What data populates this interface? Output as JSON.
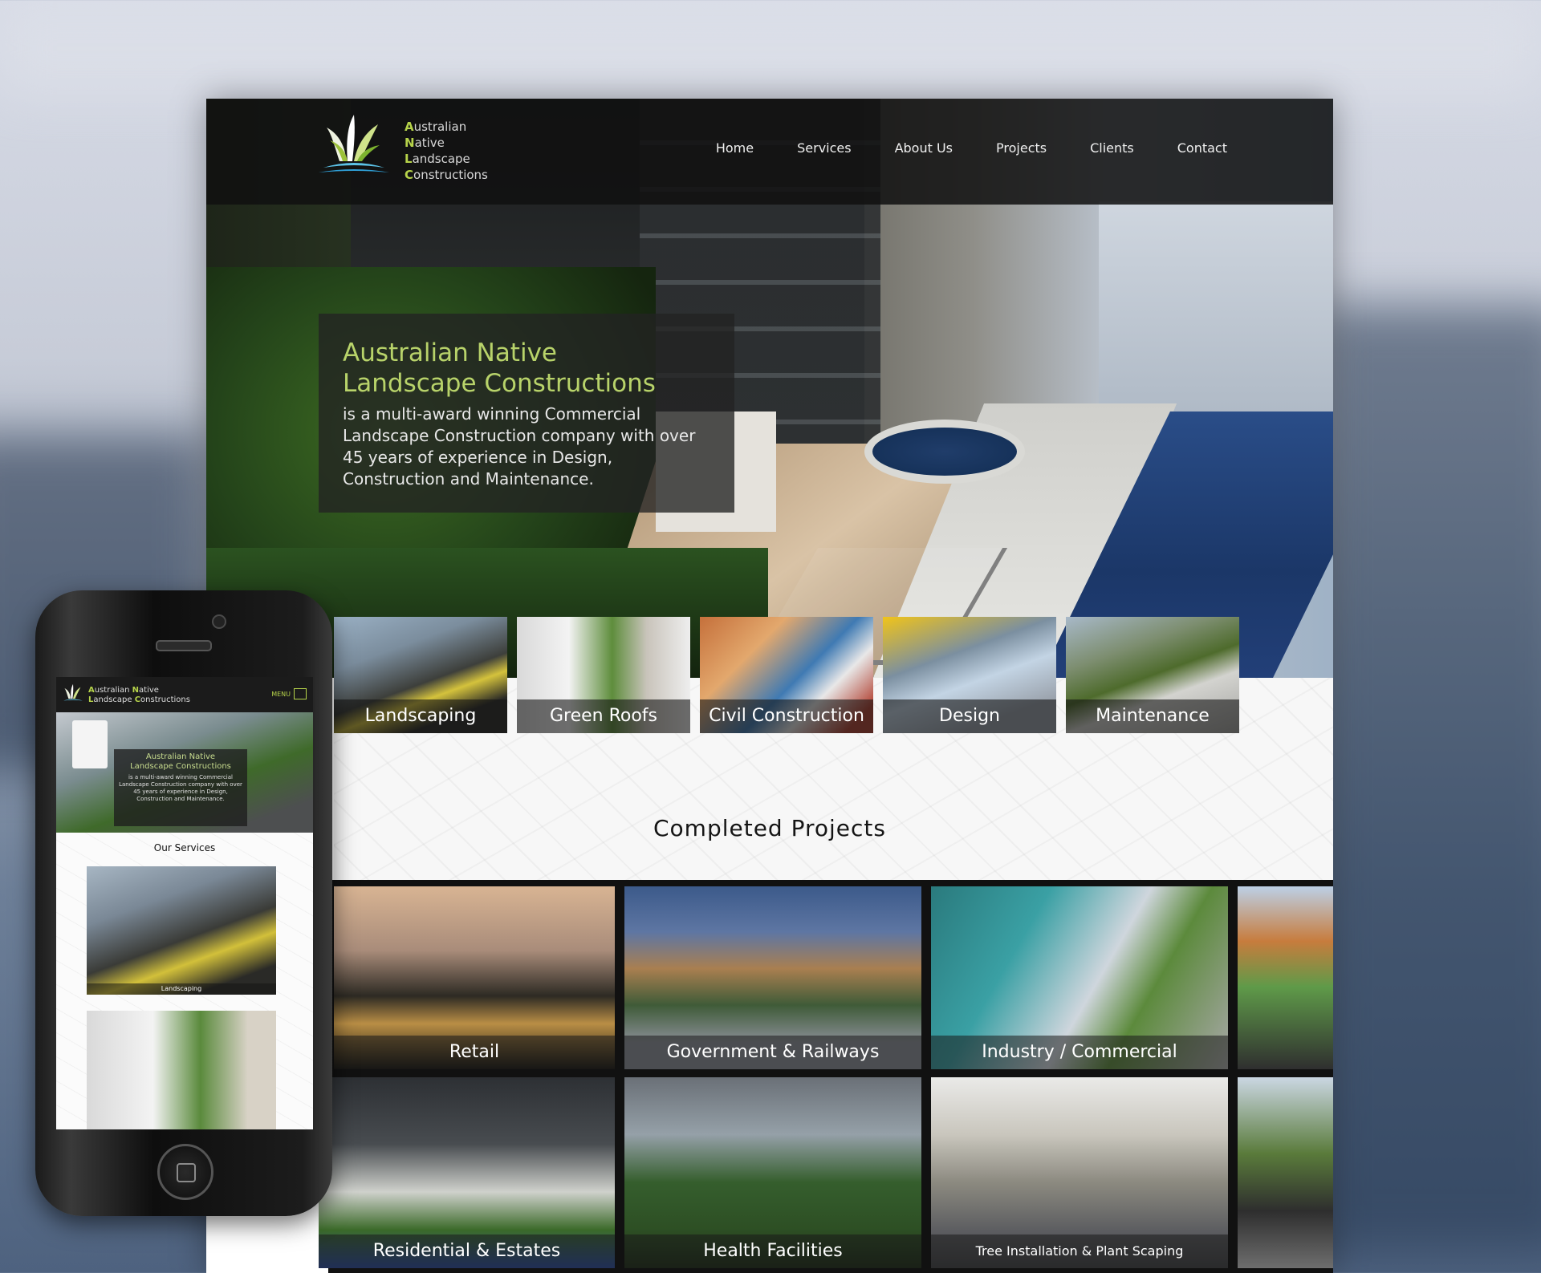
{
  "brand": {
    "line1_cap": "A",
    "line1_rest": "ustralian",
    "line2_cap": "N",
    "line2_rest": "ative",
    "line3_cap": "L",
    "line3_rest": "andscape",
    "line4_cap": "C",
    "line4_rest": "onstructions",
    "accent_color": "#b6d34a"
  },
  "nav": {
    "items": [
      "Home",
      "Services",
      "About Us",
      "Projects",
      "Clients",
      "Contact"
    ]
  },
  "hero": {
    "title_line1": "Australian Native",
    "title_line2": "Landscape Constructions",
    "description": "is a multi-award winning Commercial Landscape Construction company with over 45 years of experience in Design, Construction and Maintenance."
  },
  "services": [
    "Landscaping",
    "Green Roofs",
    "Civil Construction",
    "Design",
    "Maintenance"
  ],
  "completed_projects": {
    "title": "Completed Projects",
    "items": [
      "Retail",
      "Government & Railways",
      "Industry / Commercial",
      "",
      "Residential & Estates",
      "Health Facilities",
      "Tree Installation & Plant Scaping",
      ""
    ]
  },
  "mobile": {
    "brand_line1_cap": "A",
    "brand_line1_rest": "ustralian ",
    "brand_line1b_cap": "N",
    "brand_line1b_rest": "ative",
    "brand_line2_cap": "L",
    "brand_line2_rest": "andscape ",
    "brand_line2b_cap": "C",
    "brand_line2b_rest": "onstructions",
    "menu_label": "MENU",
    "hero_title_line1": "Australian Native",
    "hero_title_line2": "Landscape Constructions",
    "hero_description": "is a multi-award winning Commercial Landscape Construction company with over 45 years of experience in Design, Construction and Maintenance.",
    "services_title": "Our Services",
    "card1_label": "Landscaping"
  }
}
